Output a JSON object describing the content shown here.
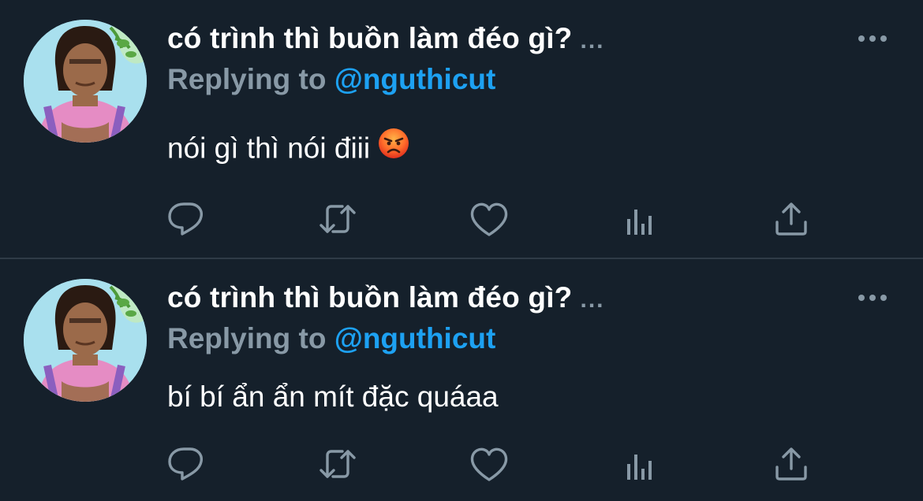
{
  "tweets": [
    {
      "display_name": "có trình thì buồn làm đéo gì?",
      "truncation": "...",
      "reply_prefix": "Replying to",
      "reply_handle": "@nguthicut",
      "text": "nói gì thì nói điii",
      "emoji": "angry-face-emoji"
    },
    {
      "display_name": "có trình thì buồn làm đéo gì?",
      "truncation": "...",
      "reply_prefix": "Replying to",
      "reply_handle": "@nguthicut",
      "text": "bí bí ẩn ẩn mít đặc quáaa"
    }
  ],
  "actions": [
    "reply-icon",
    "retweet-icon",
    "like-icon",
    "analytics-icon",
    "share-icon"
  ],
  "colors": {
    "background": "#15202b",
    "muted": "#8899a6",
    "link": "#1da1f2",
    "text": "#ffffff",
    "divider": "#2f3b47"
  }
}
